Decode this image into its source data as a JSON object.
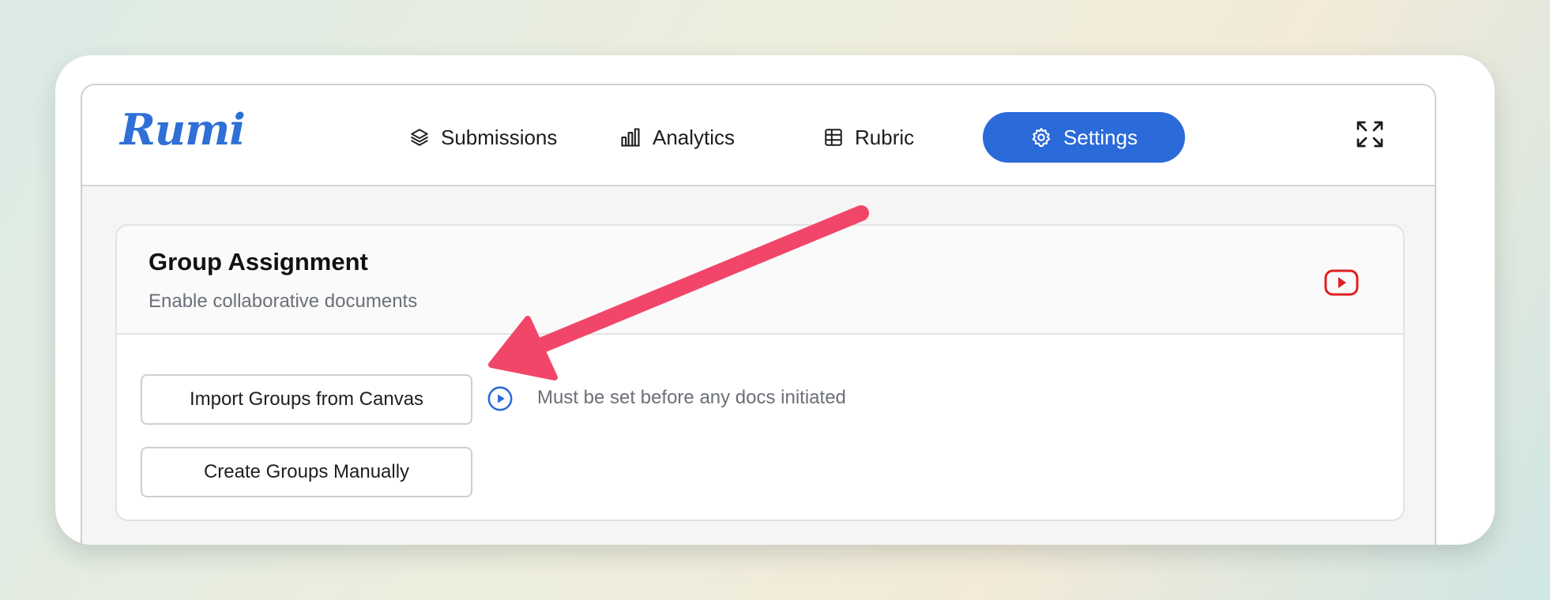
{
  "app": {
    "logo_text": "Rumi"
  },
  "nav": {
    "items": [
      {
        "label": "Submissions",
        "icon": "layers-icon",
        "active": false
      },
      {
        "label": "Analytics",
        "icon": "bar-chart-icon",
        "active": false
      },
      {
        "label": "Rubric",
        "icon": "table-icon",
        "active": false
      },
      {
        "label": "Settings",
        "icon": "gear-icon",
        "active": true
      }
    ],
    "expand_icon": "expand-icon"
  },
  "group_assignment": {
    "title": "Group Assignment",
    "subtitle": "Enable collaborative documents",
    "video_icon": "youtube-icon",
    "import_button": "Import Groups from Canvas",
    "manual_button": "Create Groups Manually",
    "hint": "Must be set before any docs initiated",
    "hint_icon": "play-circle-icon"
  },
  "colors": {
    "accent": "#2a6ad9",
    "logo": "#2f6fd6",
    "youtube": "#e02020",
    "annotation_arrow": "#f2456a",
    "muted_text": "#6b6f78"
  }
}
